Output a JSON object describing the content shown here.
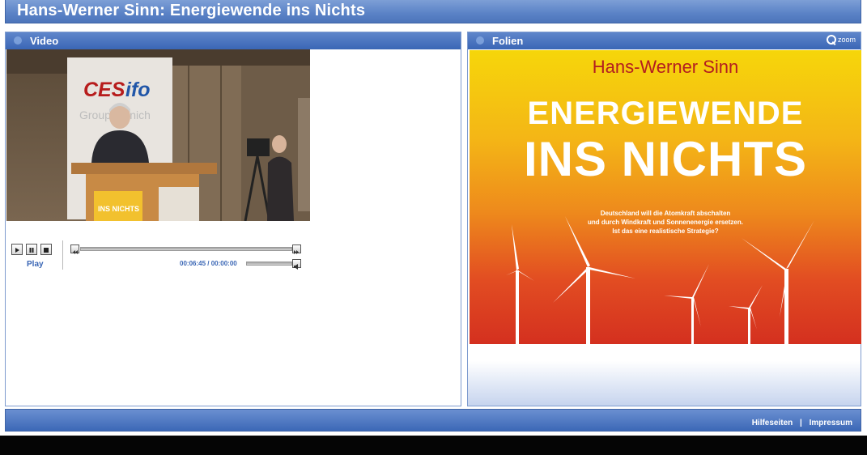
{
  "header": {
    "title": "Hans-Werner Sinn: Energiewende ins Nichts"
  },
  "video_panel": {
    "label": "Video",
    "video_sign_logo": "CESifo",
    "video_sign_sub": "Group Munich",
    "podium_book": "ENERGIEWENDE INS NICHTS",
    "controls": {
      "play_label": "Play",
      "time": "00:06:45 / 00:00:00"
    }
  },
  "slides_panel": {
    "label": "Folien",
    "zoom_label": "zoom",
    "slide": {
      "author": "Hans-Werner Sinn",
      "title_line1": "ENERGIEWENDE",
      "title_line2": "INS NICHTS",
      "subtitle_1": "Deutschland will die Atomkraft abschalten",
      "subtitle_2": "und durch Windkraft und Sonnenenergie ersetzen.",
      "subtitle_3": "Ist das eine realistische Strategie?"
    }
  },
  "footer": {
    "help_link": "Hilfeseiten",
    "separator": "|",
    "imprint_link": "Impressum"
  },
  "colors": {
    "panel_blue": "#3a66b5",
    "author_red": "#b31d20"
  },
  "icons": [
    "play-icon",
    "pause-icon",
    "stop-icon",
    "rewind-icon",
    "forward-icon",
    "volume-icon",
    "zoom-icon"
  ]
}
